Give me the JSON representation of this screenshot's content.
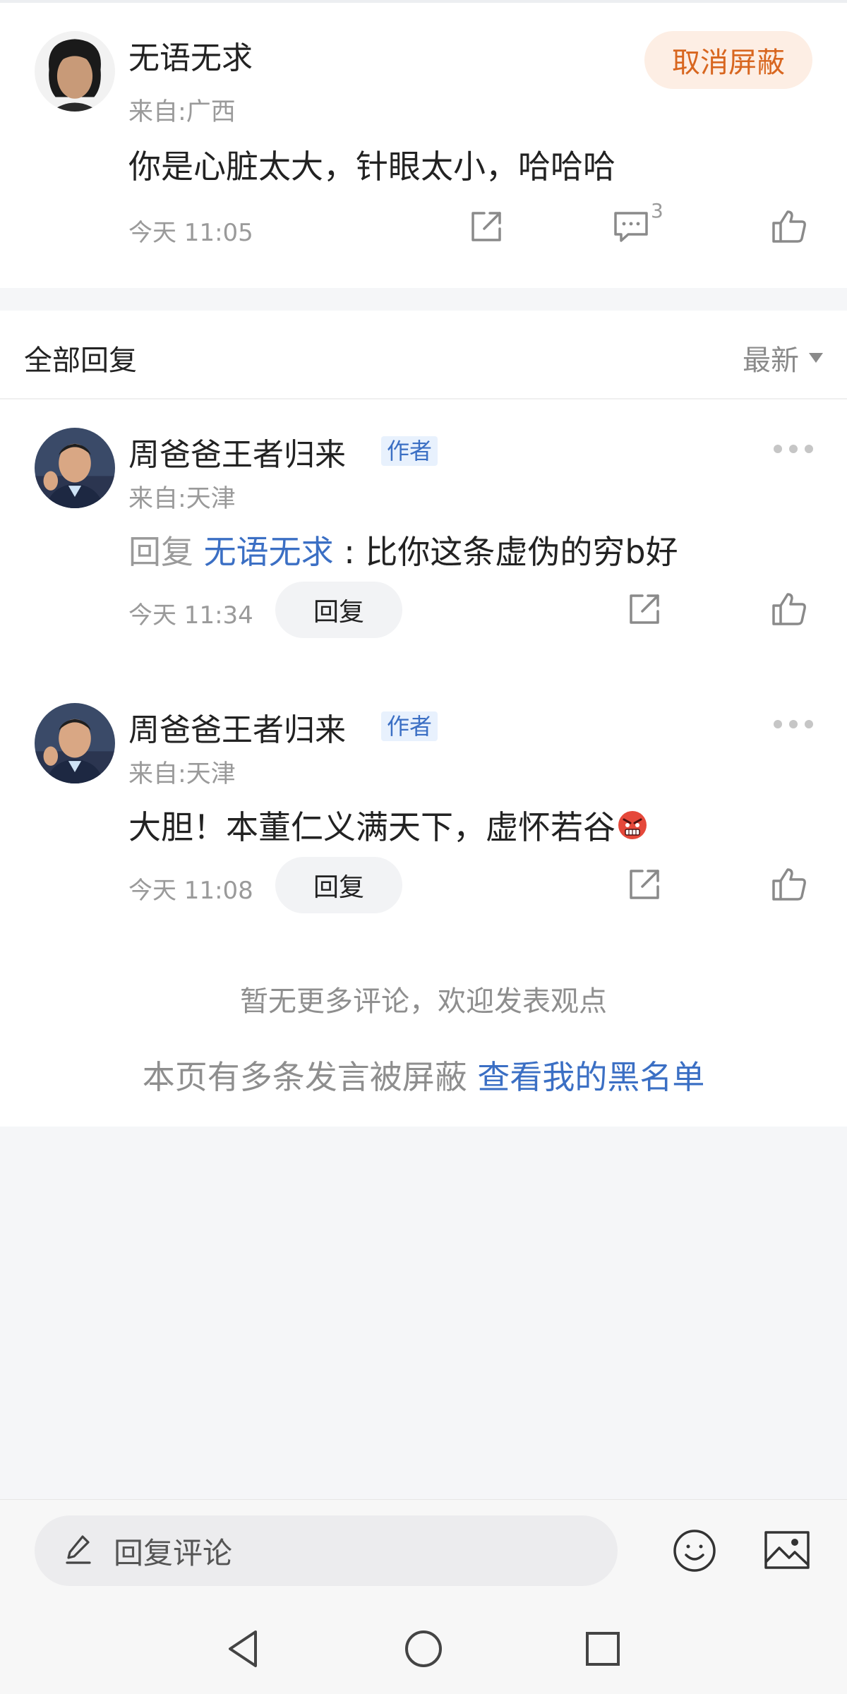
{
  "parent_comment": {
    "username": "无语无求",
    "location": "来自:广西",
    "text": "你是心脏太大，针眼太小，哈哈哈",
    "time": "今天 11:05",
    "reply_count": "3",
    "unblock_label": "取消屏蔽"
  },
  "replies_header": {
    "title": "全部回复",
    "sort_label": "最新"
  },
  "replies": [
    {
      "username": "周爸爸王者归来",
      "tag": "作者",
      "location": "来自:天津",
      "reply_prefix": "回复 ",
      "reply_target": "无语无求",
      "text": " : 比你这条虚伪的穷b好",
      "time": "今天 11:34",
      "reply_button": "回复"
    },
    {
      "username": "周爸爸王者归来",
      "tag": "作者",
      "location": "来自:天津",
      "text": "大胆！本董仁义满天下，虚怀若谷",
      "time": "今天 11:08",
      "reply_button": "回复"
    }
  ],
  "footer": {
    "no_more": "暂无更多评论，欢迎发表观点",
    "blocked_text": "本页有多条发言被屏蔽 ",
    "blacklist_link": "查看我的黑名单"
  },
  "input_bar": {
    "placeholder": "回复评论"
  },
  "colors": {
    "link_blue": "#3b6fc4",
    "unblock_orange": "#d8661f",
    "unblock_bg": "#fdeee4"
  }
}
